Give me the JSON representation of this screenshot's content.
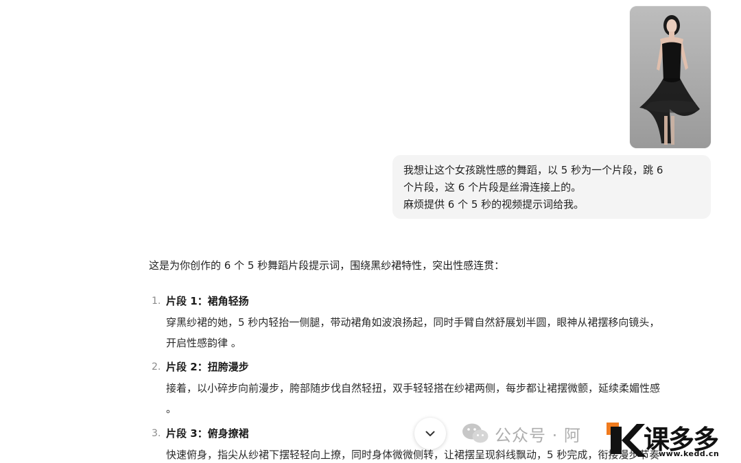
{
  "user_message": {
    "image_alt": "woman in black sheer dress photo",
    "lines": [
      "我想让这个女孩跳性感的舞蹈，以 5 秒为一个片段，跳 6",
      "个片段，这 6 个片段是丝滑连接上的。",
      "麻烦提供 6 个 5 秒的视频提示词给我。"
    ]
  },
  "assistant_message": {
    "intro": "这是为你创作的 6 个 5 秒舞蹈片段提示词，围绕黑纱裙特性，突出性感连贯：",
    "segments": [
      {
        "num": "1.",
        "title": "片段 1：裙角轻扬",
        "body_lines": [
          "穿黑纱裙的她，5 秒内轻抬一侧腿，带动裙角如波浪扬起，同时手臂自然舒展划半圆，眼神从裙摆移向镜头，",
          "开启性感韵律 。"
        ]
      },
      {
        "num": "2.",
        "title": "片段 2：扭胯漫步",
        "body_lines": [
          "接着，以小碎步向前漫步，胯部随步伐自然轻扭，双手轻轻搭在纱裙两侧，每步都让裙摆微颤，延续柔媚性感",
          "。"
        ]
      },
      {
        "num": "3.",
        "title": "片段 3：俯身撩裙",
        "body_lines": [
          "快速俯身，指尖从纱裙下摆轻轻向上撩，同时身体微微侧转，让裙摆呈现斜线飘动，5 秒完成，衔接漫步节奏"
        ]
      }
    ]
  },
  "watermark": {
    "wechat_text": "公众号 · 阿",
    "logo_text": "K课多多",
    "logo_url": "www.kedd.cn",
    "logo_color": "#f07b1e"
  },
  "icons": {
    "scroll_down": "chevron-down-icon",
    "wechat": "wechat-icon"
  }
}
